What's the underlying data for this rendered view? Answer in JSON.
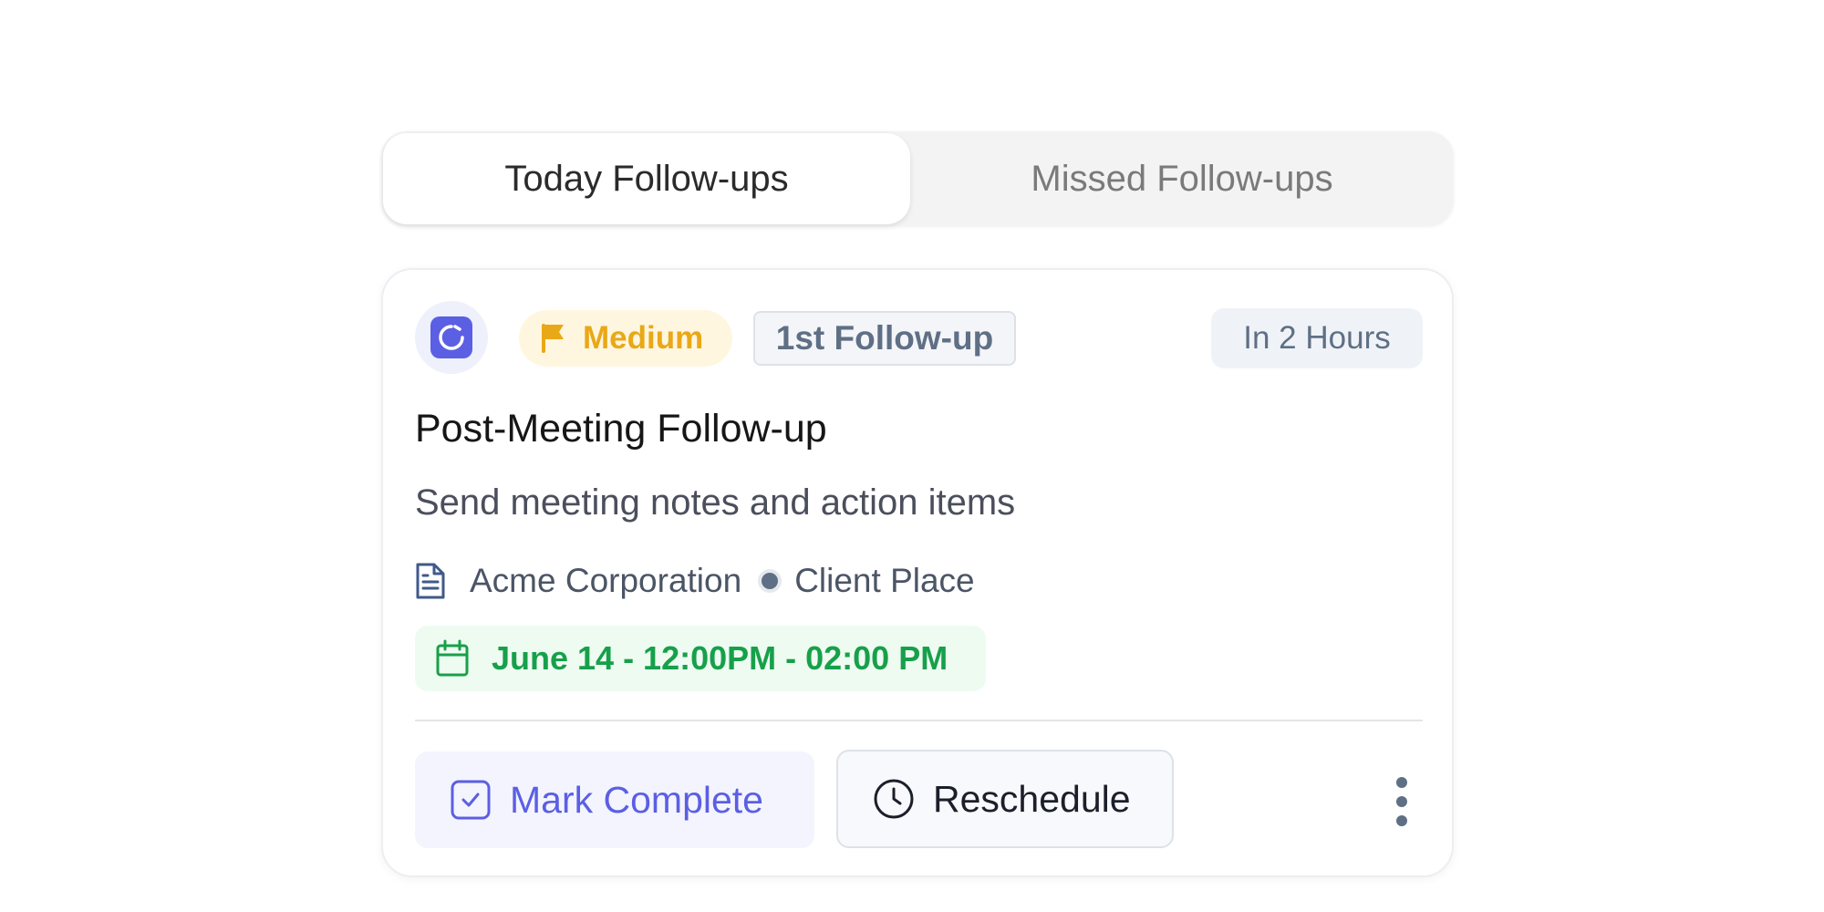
{
  "tabs": [
    {
      "label": "Today Follow-ups",
      "active": true
    },
    {
      "label": "Missed Follow-ups",
      "active": false
    }
  ],
  "card": {
    "status_icon": "refresh-square-icon",
    "priority": {
      "label": "Medium",
      "icon": "flag-icon",
      "color": "#e9a817"
    },
    "followup_badge": "1st Follow-up",
    "time_badge": "In 2 Hours",
    "title": "Post-Meeting Follow-up",
    "description": "Send meeting notes and action items",
    "company": "Acme Corporation",
    "location": "Client Place",
    "schedule": "June 14 - 12:00PM - 02:00 PM",
    "actions": {
      "complete_label": "Mark Complete",
      "reschedule_label": "Reschedule"
    }
  },
  "colors": {
    "accent": "#5b5fe3",
    "success": "#17a04a",
    "warning": "#e9a817",
    "muted": "#5f6f85"
  }
}
